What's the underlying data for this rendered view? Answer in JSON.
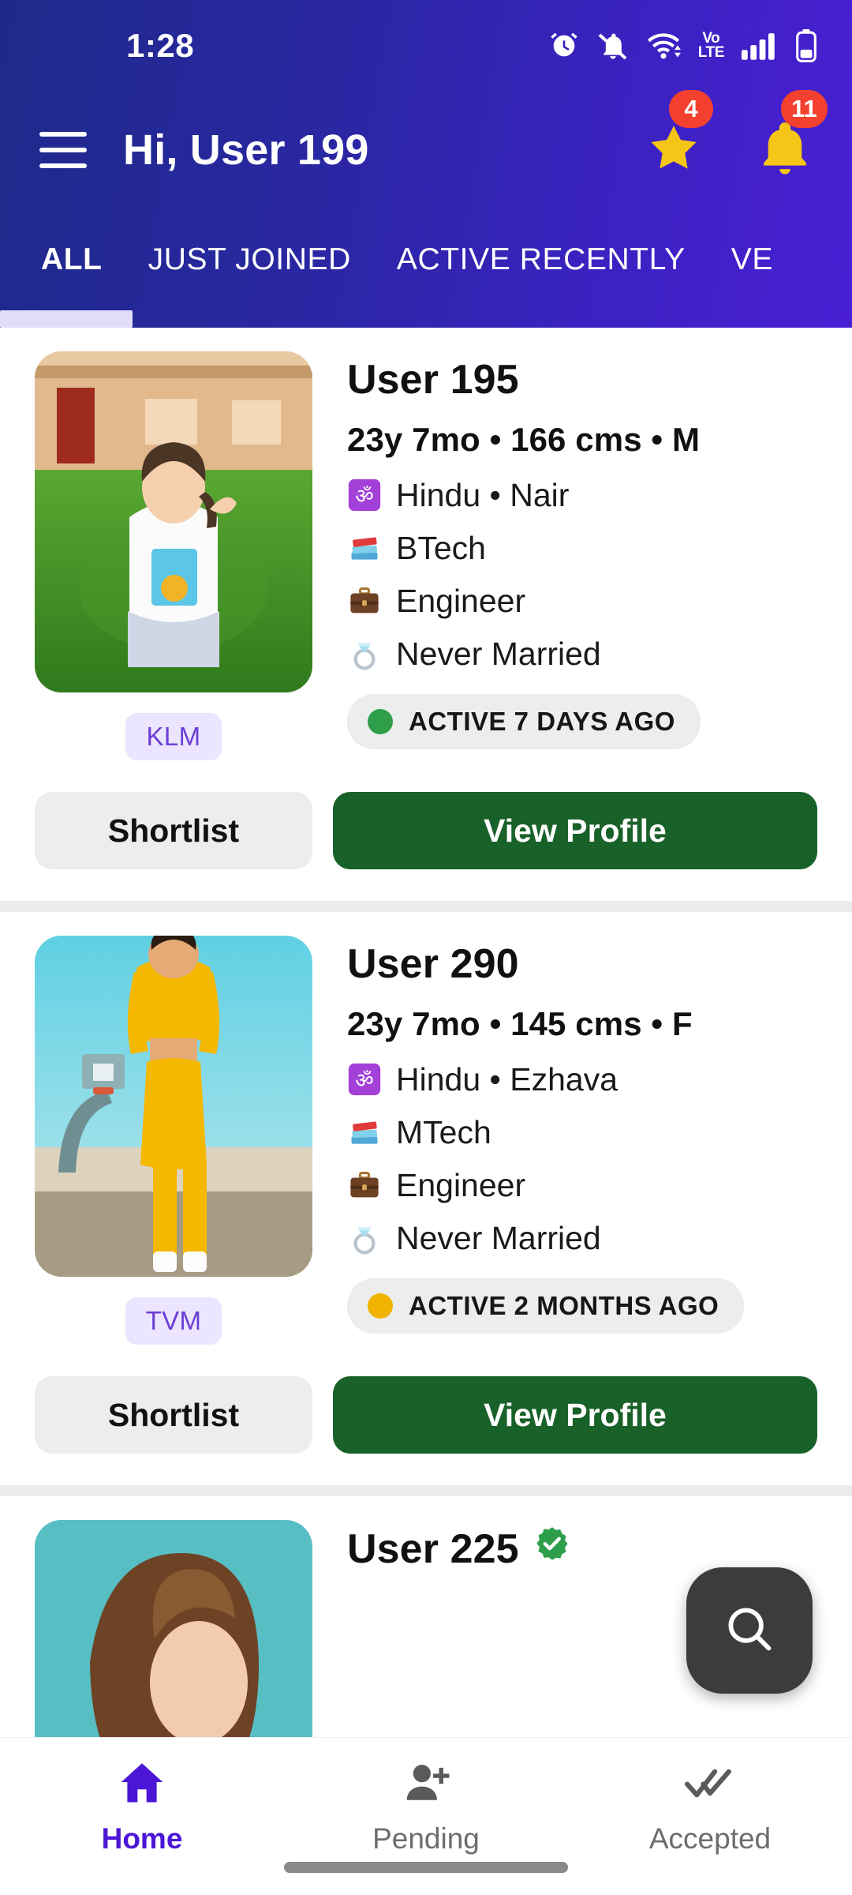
{
  "statusbar": {
    "time": "1:28",
    "icons": [
      "alarm-icon",
      "bell-muted-icon",
      "wifi-icon",
      "volte-icon",
      "signal-icon",
      "battery-icon"
    ],
    "volte_top": "Vo",
    "volte_bottom": "LTE"
  },
  "appbar": {
    "menu_icon": "hamburger-menu-icon",
    "greeting": "Hi, User 199",
    "star_badge": "4",
    "bell_badge": "11",
    "badge_color": "#f4402e",
    "star_color": "#f5c518",
    "bell_color": "#f5c518"
  },
  "tabs": {
    "items": [
      {
        "label": "ALL",
        "active": true
      },
      {
        "label": "JUST JOINED",
        "active": false
      },
      {
        "label": "ACTIVE RECENTLY",
        "active": false
      },
      {
        "label": "VE",
        "active": false
      }
    ],
    "indicator_color": "#e2dcfb"
  },
  "cards": [
    {
      "name": "User 195",
      "verified": false,
      "meta": "23y 7mo • 166 cms • M",
      "location_badge": "KLM",
      "attributes": [
        {
          "icon": "om-icon",
          "text": "Hindu • Nair"
        },
        {
          "icon": "books-icon",
          "text": "BTech"
        },
        {
          "icon": "briefcase-icon",
          "text": "Engineer"
        },
        {
          "icon": "ring-icon",
          "text": "Never Married"
        }
      ],
      "status_text": "ACTIVE 7 DAYS AGO",
      "status_dot_color": "#2e9e4b",
      "shortlist_label": "Shortlist",
      "view_label": "View Profile",
      "photo_desc": "person-sitting-on-grass-photo"
    },
    {
      "name": "User 290",
      "verified": false,
      "meta": "23y 7mo • 145 cms • F",
      "location_badge": "TVM",
      "attributes": [
        {
          "icon": "om-icon",
          "text": "Hindu • Ezhava"
        },
        {
          "icon": "books-icon",
          "text": "MTech"
        },
        {
          "icon": "briefcase-icon",
          "text": "Engineer"
        },
        {
          "icon": "ring-icon",
          "text": "Never Married"
        }
      ],
      "status_text": "ACTIVE 2 MONTHS AGO",
      "status_dot_color": "#f0b400",
      "shortlist_label": "Shortlist",
      "view_label": "View Profile",
      "photo_desc": "person-in-yellow-tracksuit-photo"
    },
    {
      "name": "User 225",
      "verified": true,
      "meta": "",
      "location_badge": "",
      "attributes": [],
      "status_text": "",
      "status_dot_color": "",
      "shortlist_label": "",
      "view_label": "",
      "photo_desc": "person-on-teal-background-photo"
    }
  ],
  "fab": {
    "icon": "search-icon",
    "bg": "#3c3c3b"
  },
  "bottomnav": {
    "items": [
      {
        "label": "Home",
        "icon": "home-icon",
        "active": true
      },
      {
        "label": "Pending",
        "icon": "person-add-icon",
        "active": false
      },
      {
        "label": "Accepted",
        "icon": "double-check-icon",
        "active": false
      }
    ],
    "active_color": "#4b16d6",
    "inactive_color": "#6d6d6d"
  }
}
